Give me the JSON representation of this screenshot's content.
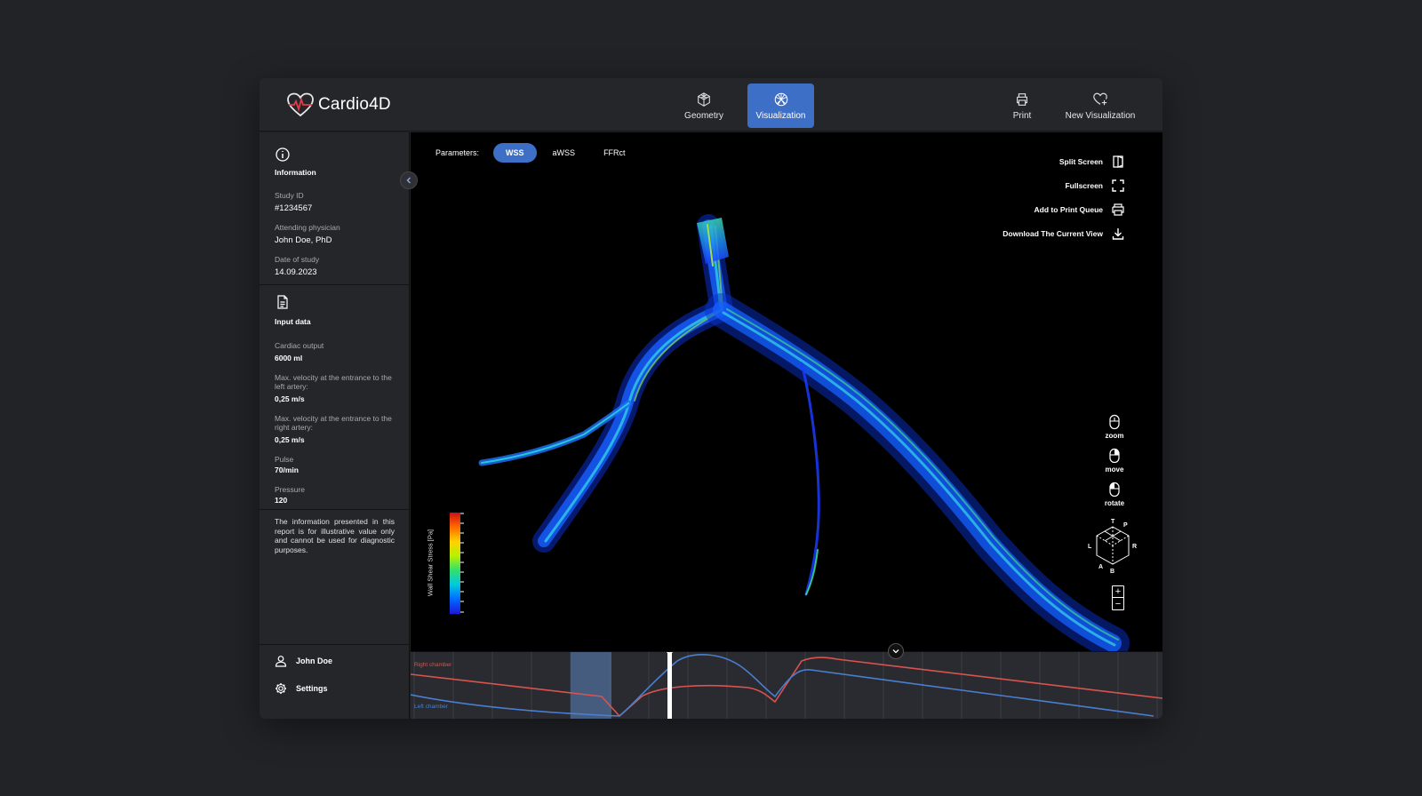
{
  "app": {
    "name": "Cardio4D"
  },
  "nav": {
    "center": [
      {
        "label": "Geometry",
        "icon": "cube-icon"
      },
      {
        "label": "Visualization",
        "icon": "network-icon",
        "active": true
      }
    ],
    "right": [
      {
        "label": "Print",
        "icon": "printer-icon"
      },
      {
        "label": "New Visualization",
        "icon": "heart-plus-icon"
      }
    ]
  },
  "info": {
    "title": "Information",
    "study_id_label": "Study ID",
    "study_id": "#1234567",
    "physician_label": "Attending physician",
    "physician": "John Doe, PhD",
    "date_label": "Date of study",
    "date": "14.09.2023"
  },
  "input_data": {
    "title": "Input data",
    "cardiac_output_label": "Cardiac output",
    "cardiac_output": "6000 ml",
    "left_velocity_label": "Max. velocity at the entrance to the left artery:",
    "left_velocity": "0,25 m/s",
    "right_velocity_label": "Max. velocity at the entrance to the right artery:",
    "right_velocity": "0,25 m/s",
    "pulse_label": "Pulse",
    "pulse": "70/min",
    "pressure_label": "Pressure",
    "pressure": "120"
  },
  "disclaimer": "The information presented in this report is for illustrative value only and cannot be used for diagnostic purposes.",
  "user": {
    "name": "John Doe",
    "settings_label": "Settings"
  },
  "parameters": {
    "label": "Parameters:",
    "options": [
      "WSS",
      "aWSS",
      "FFRct"
    ],
    "selected": "WSS"
  },
  "view_tools": [
    "Split Screen",
    "Fullscreen",
    "Add to Print Queue",
    "Download The Current View"
  ],
  "mouse_controls": [
    "zoom",
    "move",
    "rotate"
  ],
  "orientation_cube": {
    "labels": [
      "T",
      "P",
      "L",
      "R",
      "A",
      "B"
    ]
  },
  "colorbar": {
    "label": "Wall Shear Stress [Pa]"
  },
  "timeline": {
    "right_label": "Right chamber",
    "left_label": "Left chamber",
    "right_color": "#d9534f",
    "left_color": "#4a7fd0",
    "highlight_color": "#4f6e99",
    "accent": "#3d6fc7"
  }
}
